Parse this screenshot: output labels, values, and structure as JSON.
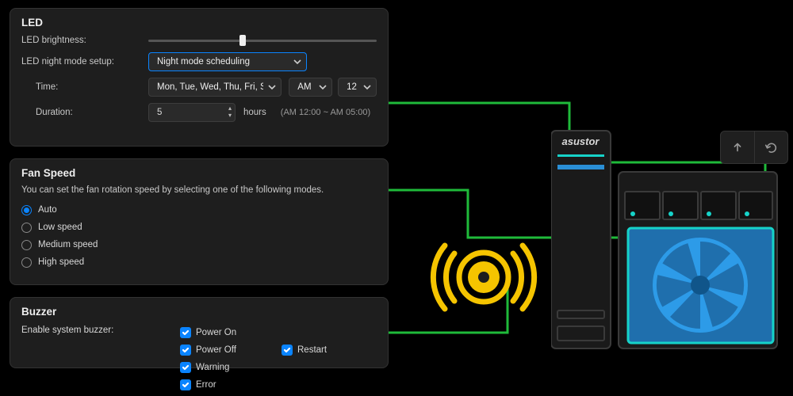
{
  "led": {
    "title": "LED",
    "brightness_label": "LED brightness:",
    "brightness_percent": 40,
    "night_mode_label": "LED night mode setup:",
    "night_mode_value": "Night mode scheduling",
    "time_label": "Time:",
    "days_value": "Mon, Tue, Wed, Thu, Fri, Sat, Sun",
    "ampm_value": "AM",
    "hour_value": "12",
    "duration_label": "Duration:",
    "duration_value": "5",
    "duration_unit": "hours",
    "duration_range": "(AM 12:00 ~ AM 05:00)"
  },
  "fan": {
    "title": "Fan Speed",
    "desc": "You can set the fan rotation speed by selecting one of the following modes.",
    "selected": "auto",
    "options": [
      {
        "id": "auto",
        "label": "Auto"
      },
      {
        "id": "low",
        "label": "Low speed"
      },
      {
        "id": "medium",
        "label": "Medium speed"
      },
      {
        "id": "high",
        "label": "High speed"
      }
    ]
  },
  "buzzer": {
    "title": "Buzzer",
    "enable_label": "Enable system buzzer:",
    "options": [
      {
        "id": "power_on",
        "label": "Power On",
        "checked": true
      },
      {
        "id": "power_off",
        "label": "Power Off",
        "checked": true
      },
      {
        "id": "restart",
        "label": "Restart",
        "checked": true
      },
      {
        "id": "warning",
        "label": "Warning",
        "checked": true
      },
      {
        "id": "error",
        "label": "Error",
        "checked": true
      }
    ]
  },
  "device": {
    "brand": "asustor"
  },
  "colors": {
    "accent_blue": "#0a84ff",
    "connector_green": "#1db954",
    "buzzer_yellow": "#f5c400",
    "device_blue": "#2a8fd6",
    "device_cyan": "#16d3c9"
  }
}
